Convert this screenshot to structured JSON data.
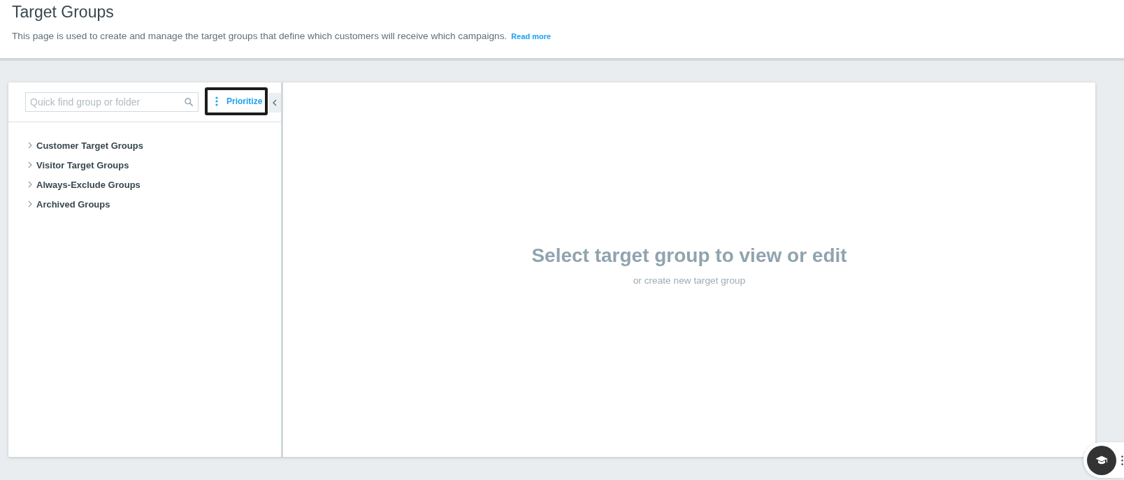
{
  "page_header": {
    "title": "Target Groups",
    "description": "This page is used to create and manage the target groups that define which customers will receive which campaigns.",
    "read_more_link": "Read more"
  },
  "sidebar": {
    "search": {
      "placeholder": "Quick find group or folder"
    },
    "prioritize_button": {
      "label": "Prioritize",
      "focused": true
    },
    "tree": [
      {
        "label": "Customer Target Groups",
        "expanded": false
      },
      {
        "label": "Visitor Target Groups",
        "expanded": false
      },
      {
        "label": "Always-Exclude Groups",
        "expanded": false
      },
      {
        "label": "Archived Groups",
        "expanded": false
      }
    ]
  },
  "main": {
    "empty_title": "Select target group to view or edit",
    "empty_subtitle": "or create new target group"
  }
}
